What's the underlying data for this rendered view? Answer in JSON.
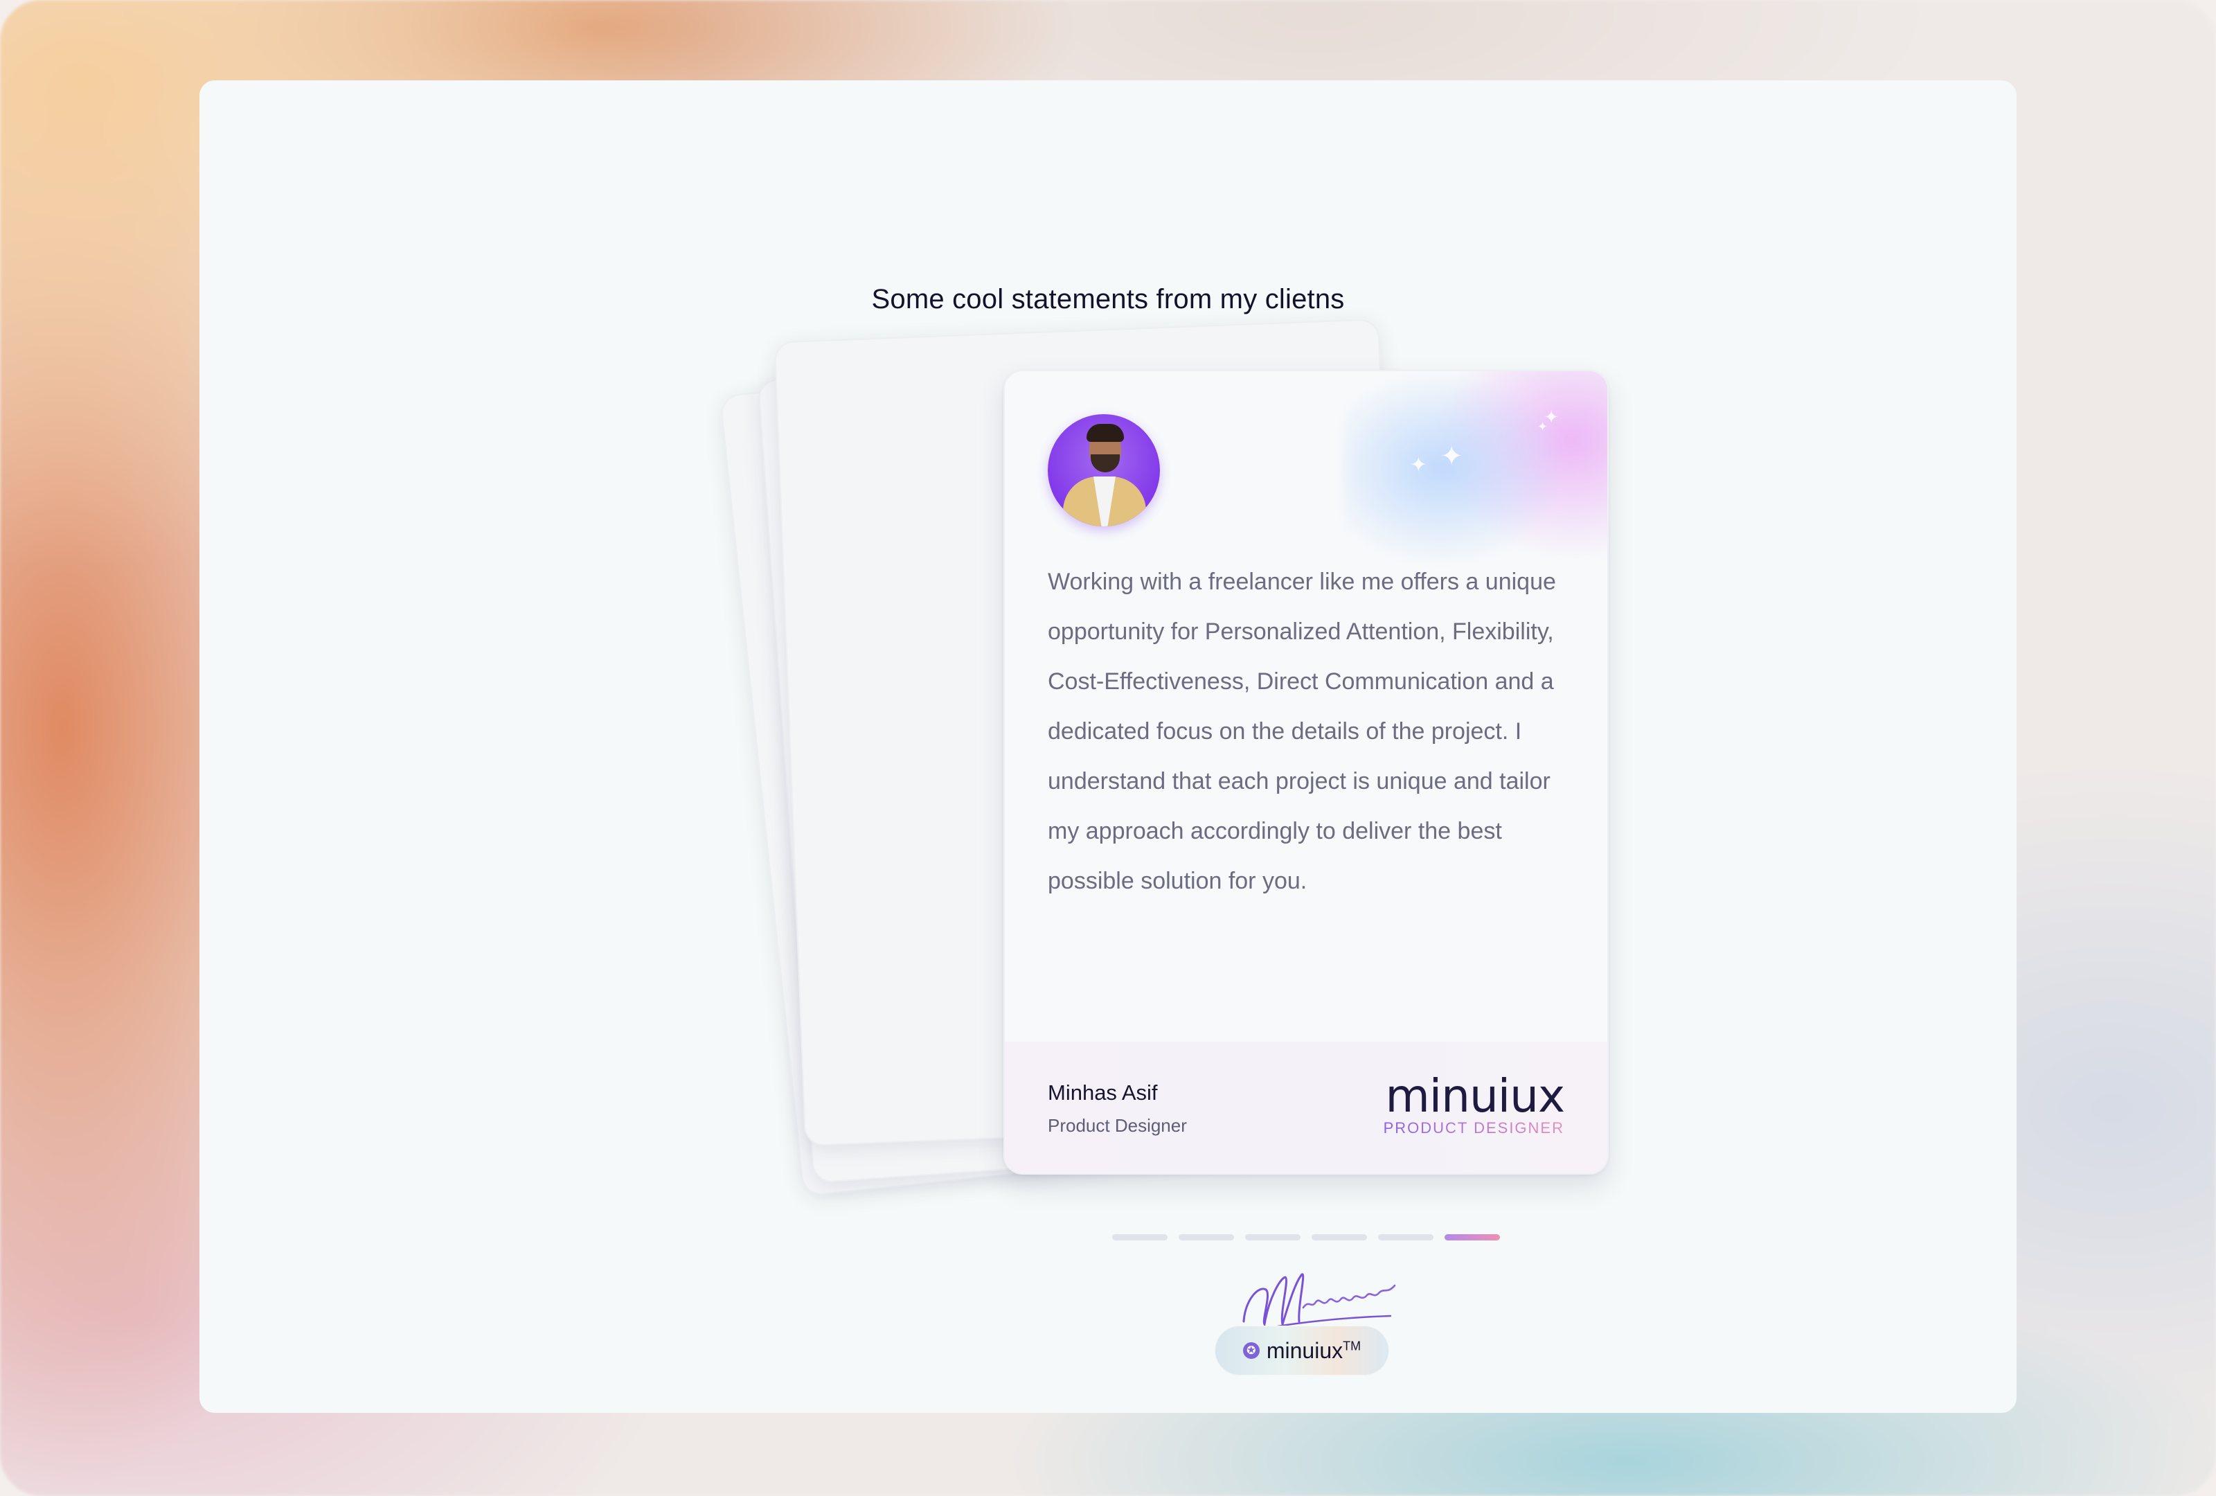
{
  "section": {
    "heading": "Some cool statements from my clietns"
  },
  "testimonial": {
    "quote": "Working with a freelancer like me offers a unique opportunity for Personalized Attention, Flexibility, Cost-Effectiveness, Direct Communication and a dedicated focus on the details of the project. I understand that each project is unique and tailor my approach accordingly to deliver the best possible solution for you.",
    "author_name": "Minhas Asif",
    "author_role": "Product Designer",
    "brand_word": "minuiux",
    "brand_sub": "PRODUCT DESIGNER"
  },
  "pager": {
    "count": 6,
    "active_index": 5
  },
  "footer": {
    "signature_text": "Minuiux",
    "badge_text": "minuiux",
    "badge_tm": "TM"
  },
  "colors": {
    "accent_purple": "#8238ea",
    "accent_pink": "#ef8fb4",
    "panel_bg": "#f6f9f9",
    "text_dark": "#14122b"
  }
}
